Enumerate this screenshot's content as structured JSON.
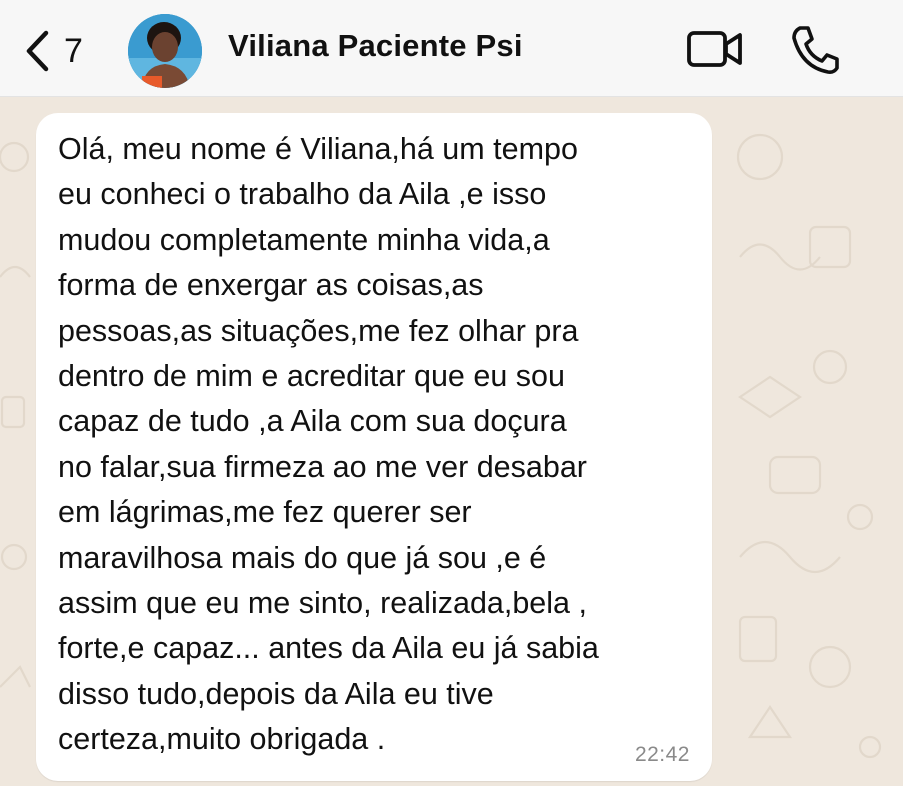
{
  "header": {
    "back_count": "7",
    "contact_name": "Viliana Paciente Psi",
    "icons": [
      "chevron-left-icon",
      "video-camera-icon",
      "phone-icon"
    ]
  },
  "message": {
    "text": "Olá, meu nome é Viliana,há um tempo\neu conheci o trabalho da Aila ,e isso\nmudou completamente minha vida,a\nforma de enxergar as coisas,as\npessoas,as situações,me fez olhar pra\ndentro de mim e acreditar que eu sou\ncapaz de tudo ,a Aila com sua doçura\nno falar,sua firmeza ao me ver desabar\nem lágrimas,me fez querer ser\nmaravilhosa mais do que já sou ,e é\nassim que eu me sinto, realizada,bela ,\nforte,e capaz... antes da Aila eu já sabia\ndisso tudo,depois da Aila eu tive\ncerteza,muito obrigada .",
    "time": "22:42"
  },
  "colors": {
    "header_bg": "#f7f7f7",
    "wallpaper": "#efe7dd",
    "bubble": "#ffffff",
    "timestamp": "#8a8a8a"
  }
}
